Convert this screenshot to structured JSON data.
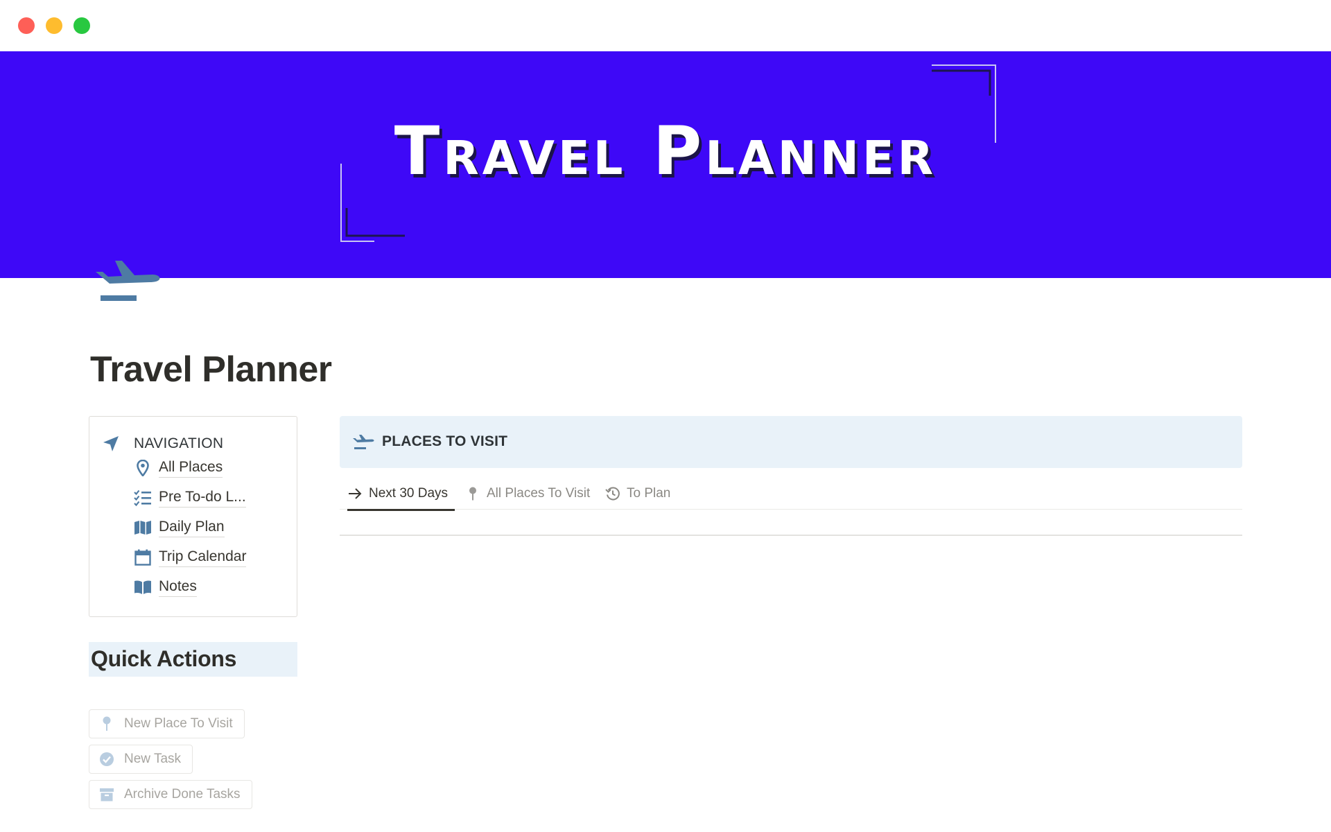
{
  "window": {
    "controls": [
      "close",
      "minimize",
      "zoom"
    ]
  },
  "cover": {
    "title": "Travel Planner",
    "background_color": "#3e08f7"
  },
  "page": {
    "icon": "airplane-departure-icon",
    "title": "Travel Planner"
  },
  "navigation": {
    "icon": "location-arrow-icon",
    "label": "NAVIGATION",
    "items": [
      {
        "label": "All Places",
        "icon": "map-pin-icon"
      },
      {
        "label": "Pre To-do L...",
        "icon": "checklist-icon"
      },
      {
        "label": "Daily Plan",
        "icon": "map-icon"
      },
      {
        "label": "Trip Calendar",
        "icon": "calendar-icon"
      },
      {
        "label": "Notes",
        "icon": "book-icon"
      }
    ]
  },
  "quick_actions": {
    "heading": "Quick Actions",
    "buttons": [
      {
        "label": "New Place To Visit",
        "icon": "pushpin-icon"
      },
      {
        "label": "New Task",
        "icon": "check-circle-icon"
      },
      {
        "label": "Archive Done Tasks",
        "icon": "archive-icon"
      }
    ]
  },
  "places": {
    "icon": "airplane-departure-icon",
    "heading": "PLACES TO VISIT",
    "tabs": [
      {
        "label": "Next 30 Days",
        "icon": "arrow-right-icon",
        "active": true
      },
      {
        "label": "All Places To Visit",
        "icon": "pushpin-icon",
        "active": false
      },
      {
        "label": "To Plan",
        "icon": "history-icon",
        "active": false
      }
    ]
  },
  "colors": {
    "accent_blue": "#4e7ba3",
    "callout_bg": "#e9f2f9"
  }
}
